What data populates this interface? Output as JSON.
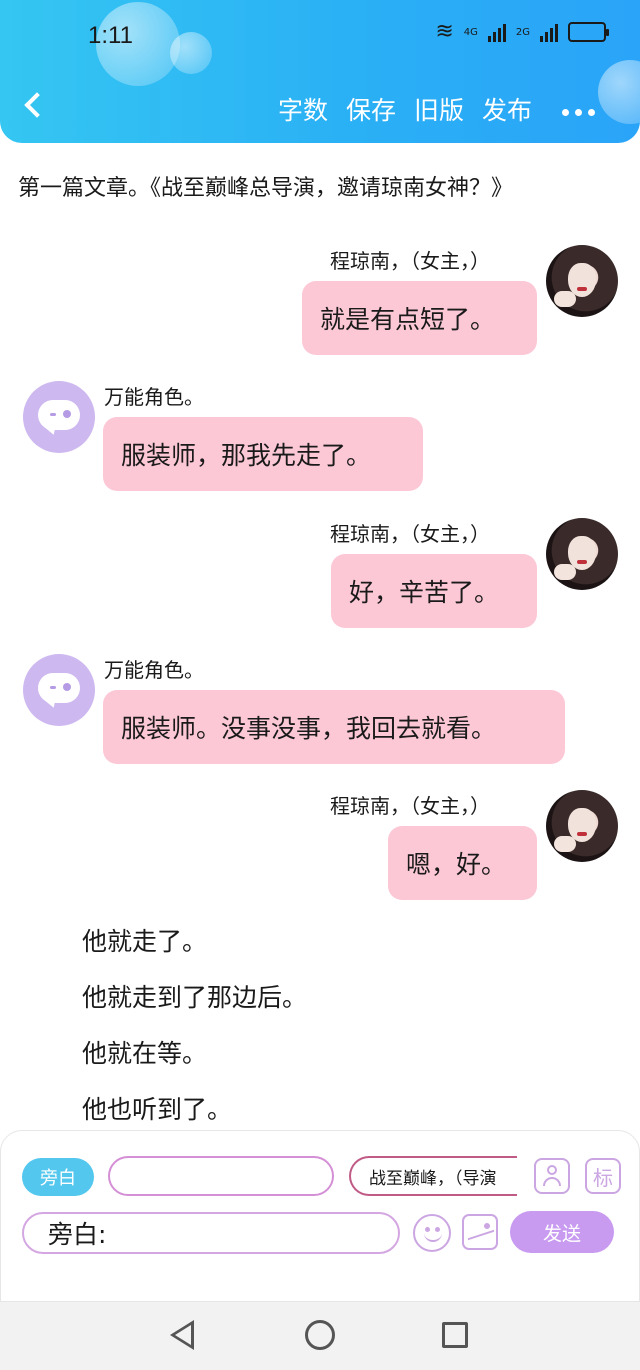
{
  "status_bar": {
    "time": "1:11",
    "network_1": "4G",
    "network_2": "2G"
  },
  "toolbar": {
    "items": [
      "字数",
      "保存",
      "旧版",
      "发布"
    ]
  },
  "doc_title": "第一篇文章。《战至巅峰总导演，邀请琼南女神？》",
  "messages": [
    {
      "side": "right",
      "speaker": "程琼南，（女主，）",
      "text": "就是有点短了。",
      "avatar": "photo-avatar"
    },
    {
      "side": "left",
      "speaker": "万能角色。",
      "text": "服装师，那我先走了。",
      "avatar": "chat-bot-avatar"
    },
    {
      "side": "right",
      "speaker": "程琼南，（女主，）",
      "text": "好，辛苦了。",
      "avatar": "photo-avatar"
    },
    {
      "side": "left",
      "speaker": "万能角色。",
      "text": "服装师。没事没事，我回去就看。",
      "avatar": "chat-bot-avatar"
    },
    {
      "side": "right",
      "speaker": "程琼南，（女主，）",
      "text": "嗯，好。",
      "avatar": "photo-avatar"
    }
  ],
  "narration": [
    "他就走了。",
    "他就走到了那边后。",
    "他就在等。",
    "他也听到了。"
  ],
  "input_panel": {
    "role_chip": "旁白",
    "name_input_value": "",
    "scene_chip": "战至巅峰，（导演",
    "tag_button": "标",
    "prefix": "旁白:",
    "text_value": "",
    "send_label": "发送"
  },
  "colors": {
    "header": "#2ab0f5",
    "bubble": "#fcc8d6",
    "accent_purple": "#c89af0",
    "role_chip": "#54c7ee"
  }
}
